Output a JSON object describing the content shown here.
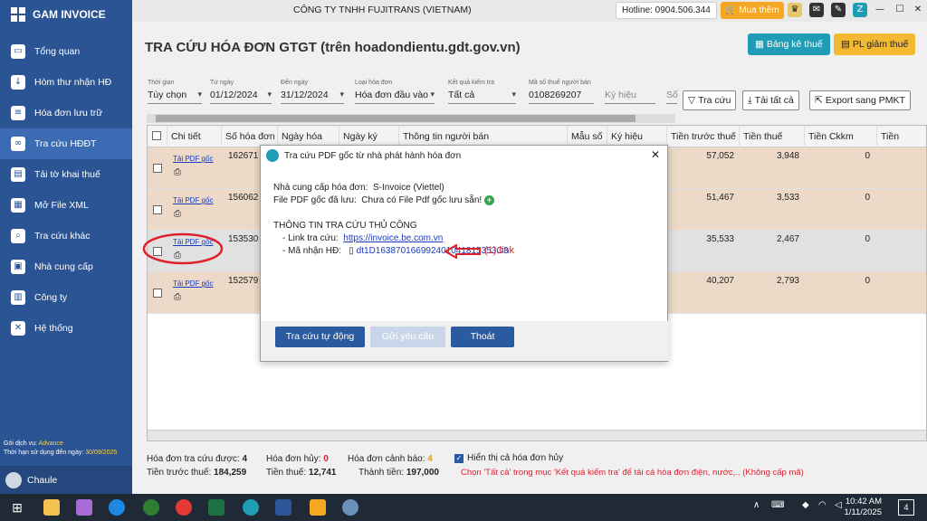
{
  "brand": "GAM INVOICE",
  "sidebar": {
    "items": [
      {
        "label": "Tổng quan",
        "icon": "monitor-icon"
      },
      {
        "label": "Hòm thư nhận HĐ",
        "icon": "inbox-icon"
      },
      {
        "label": "Hóa đơn lưu trữ",
        "icon": "archive-icon"
      },
      {
        "label": "Tra cứu HĐĐT",
        "icon": "link-icon"
      },
      {
        "label": "Tải tờ khai thuế",
        "icon": "download-doc-icon"
      },
      {
        "label": "Mở File XML",
        "icon": "xml-file-icon"
      },
      {
        "label": "Tra cứu khác",
        "icon": "search-icon"
      },
      {
        "label": "Nhà cung cấp",
        "icon": "supplier-icon"
      },
      {
        "label": "Công ty",
        "icon": "company-icon"
      },
      {
        "label": "Hệ thống",
        "icon": "tools-icon"
      }
    ],
    "service_label": "Gói dịch vụ:",
    "service_value": "Advance",
    "expiry_label": "Thời hạn sử dụng đến ngày:",
    "expiry_value": "30/09/2025",
    "user": "Chaule"
  },
  "topbar": {
    "company": "CÔNG TY TNHH FUJITRANS (VIETNAM)",
    "hotline": "Hotline: 0904.506.344",
    "buy": "Mua thêm"
  },
  "page": {
    "title": "TRA CỨU HÓA ĐƠN GTGT (trên hoadondientu.gdt.gov.vn)",
    "btn_list": "Bảng kê thuế",
    "btn_pl": "PL giảm thuế"
  },
  "filters": {
    "time_label": "Thời gian",
    "time_value": "Tùy chọn",
    "from_label": "Từ ngày",
    "from_value": "01/12/2024",
    "to_label": "Đến ngày",
    "to_value": "31/12/2024",
    "type_label": "Loại hóa đơn",
    "type_value": "Hóa đơn đầu vào",
    "result_label": "Kết quả kiểm tra",
    "result_value": "Tất cả",
    "tax_label": "Mã số thuế người bán",
    "tax_value": "0108269207",
    "symbol_ph": "Ký hiệu",
    "no_ph": "Số",
    "btn_search": "Tra cứu",
    "btn_download": "Tải tất cả",
    "btn_export": "Export sang PMKT"
  },
  "grid": {
    "headers": [
      "Chi tiết",
      "Số hóa đơn",
      "Ngày hóa đơn",
      "Ngày ký",
      "Thông tin người bán",
      "Mẫu số",
      "Ký hiệu",
      "Tiền trước thuế",
      "Tiền thuế",
      "Tiền Ckkm",
      "Tiền"
    ],
    "pdf_link": "Tải PDF gốc",
    "rows": [
      {
        "invoice": "162671",
        "pretax": "57,052",
        "tax": "3,948",
        "ckkm": "0"
      },
      {
        "invoice": "156062",
        "pretax": "51,467",
        "tax": "3,533",
        "ckkm": "0"
      },
      {
        "invoice": "153530",
        "pretax": "35,533",
        "tax": "2,467",
        "ckkm": "0"
      },
      {
        "invoice": "152579",
        "pretax": "40,207",
        "tax": "2,793",
        "ckkm": "0"
      }
    ]
  },
  "modal": {
    "title": "Tra cứu PDF gốc từ nhà phát hành hóa đơn",
    "provider_label": "Nhà cung cấp hóa đơn:",
    "provider_value": "S-Invoice (Viettel)",
    "saved_label": "File PDF gốc đã lưu:",
    "saved_value": "Chưa có File Pdf gốc lưu sẵn!",
    "section": "THÔNG TIN TRA CỨU THỦ CÔNG",
    "link_label": "- Link tra cứu:",
    "link_value": "https://invoice.be.com.vn",
    "code_label": "- Mã nhận HĐ:",
    "code_value": "dt1D163870166992401041815353O3",
    "btn_auto": "Tra cứu tự động",
    "btn_request": "Gửi yêu cầu",
    "btn_exit": "Thoát"
  },
  "annotation": "(1):link",
  "summary": {
    "count_label": "Hóa đơn tra cứu được:",
    "count_value": "4",
    "cancel_label": "Hóa đơn hủy:",
    "cancel_value": "0",
    "warn_label": "Hóa đơn cảnh báo:",
    "warn_value": "4",
    "show_cancel": "Hiển thị cả hóa đơn hủy",
    "pretax_label": "Tiền trước thuế:",
    "pretax_value": "184,259",
    "tax_label": "Tiền thuế:",
    "tax_value": "12,741",
    "total_label": "Thành tiền:",
    "total_value": "197,000",
    "note": "Chọn 'Tất cả' trong mục 'Kết quả kiểm tra' để tải cả hóa đơn điện, nước,.. (Không cấp mã)"
  },
  "taskbar": {
    "time": "10:42 AM",
    "date": "1/11/2025",
    "notif": "4"
  },
  "colors": {
    "sidebar": "#2b5494",
    "accent_teal": "#1f9db5",
    "accent_gold": "#f3b931",
    "annotation_red": "#e0202c",
    "link_blue": "#1a3cbf"
  }
}
